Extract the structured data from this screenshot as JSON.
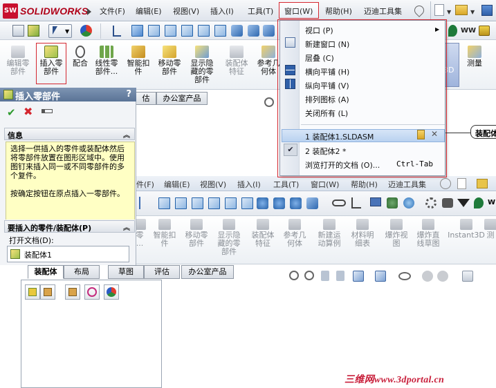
{
  "app": {
    "logo_text": "SOLIDWORKS",
    "logo_mark": "SW"
  },
  "menubar": {
    "items": [
      "文件(F)",
      "编辑(E)",
      "视图(V)",
      "插入(I)",
      "工具(T)",
      "窗口(W)",
      "帮助(H)",
      "迈迪工具集"
    ]
  },
  "back_menubar": {
    "items": [
      "件(F)",
      "编辑(E)",
      "视图(V)",
      "插入(I)",
      "工具(T)",
      "窗口(W)",
      "帮助(H)",
      "迈迪工具集"
    ]
  },
  "command_manager": {
    "buttons": [
      {
        "label": "编辑零\n部件",
        "state": "disabled"
      },
      {
        "label": "插入零\n部件",
        "state": "highlight"
      },
      {
        "label": "配合",
        "state": "normal"
      },
      {
        "label": "线性零\n部件...",
        "state": "normal"
      },
      {
        "label": "智能扣\n件",
        "state": "normal"
      },
      {
        "label": "移动零\n部件",
        "state": "normal"
      },
      {
        "label": "显示隐\n藏的零\n部件",
        "state": "normal"
      },
      {
        "label": "装配体\n特征",
        "state": "disabled"
      },
      {
        "label": "参考几\n何体",
        "state": "normal"
      }
    ],
    "right_buttons": [
      {
        "label": "3D"
      },
      {
        "label": "测量"
      }
    ]
  },
  "back_command_manager": {
    "buttons": [
      "零\n...",
      "智能扣\n件",
      "移动零\n部件",
      "显示隐\n藏的零\n部件",
      "装配体\n特征",
      "参考几\n何体",
      "新建运\n动算例",
      "材料明\n细表",
      "爆炸视\n图",
      "爆炸直\n线草图",
      "Instant3D",
      "测"
    ]
  },
  "property_manager": {
    "title": "插入零部件",
    "help_glyph": "?",
    "sections": {
      "info_header": "信息",
      "info_text_1": "选择一供插入的零件或装配体然后将零部件放置在图形区域中。使用图钉来插入同一或不同零部件的多个复件。",
      "info_text_2": "按确定按钮在原点插入一零部件。",
      "parts_header": "要插入的零件/装配体(P)",
      "open_docs_label": "打开文档(D):",
      "open_docs_item": "装配体1"
    }
  },
  "front_tabs": [
    "估",
    "办公室产品"
  ],
  "back_tabs": [
    "装配体",
    "布局",
    "草图",
    "评估",
    "办公室产品"
  ],
  "window_menu": {
    "items": [
      {
        "label": "视口 (P)",
        "submenu": true
      },
      {
        "label": "新建窗口 (N)"
      },
      {
        "label": "层叠 (C)"
      },
      {
        "label": "横向平铺 (H)"
      },
      {
        "label": "纵向平铺 (V)"
      },
      {
        "label": "排列图标 (A)"
      },
      {
        "label": "关闭所有 (L)"
      }
    ],
    "windows": [
      {
        "label": "1 装配体1.SLDASM",
        "selected": true
      },
      {
        "label": "2 装配体2 *",
        "checked": true
      },
      {
        "label": "浏览打开的文档 (O)...",
        "accel": "Ctrl-Tab"
      }
    ],
    "check_glyph": "✔",
    "submenu_glyph": "▶"
  },
  "callout": {
    "text": "装配体"
  },
  "watermark": {
    "text": "三维网www.3dportal.cn"
  },
  "colors": {
    "accent_red": "#d4262f",
    "brand_red": "#c8102e",
    "info_yellow": "#ffffc4",
    "pm_title_blue": "#5a7396",
    "selection_blue": "#b9d2f0"
  }
}
